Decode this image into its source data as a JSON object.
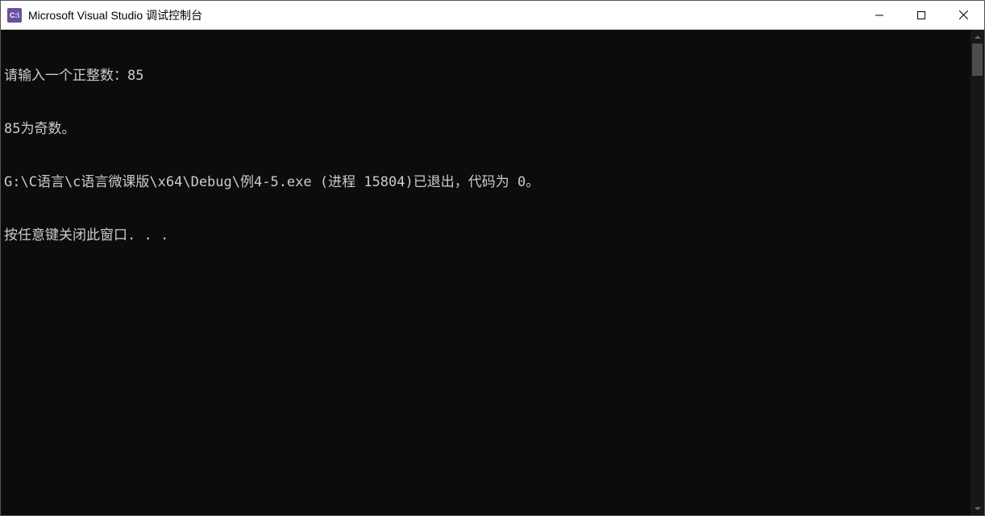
{
  "window": {
    "title": "Microsoft Visual Studio 调试控制台",
    "icon_label": "C:\\"
  },
  "console": {
    "lines": [
      "请输入一个正整数：85",
      "85为奇数。",
      "G:\\C语言\\c语言微课版\\x64\\Debug\\例4-5.exe (进程 15804)已退出，代码为 0。",
      "按任意键关闭此窗口. . ."
    ]
  }
}
